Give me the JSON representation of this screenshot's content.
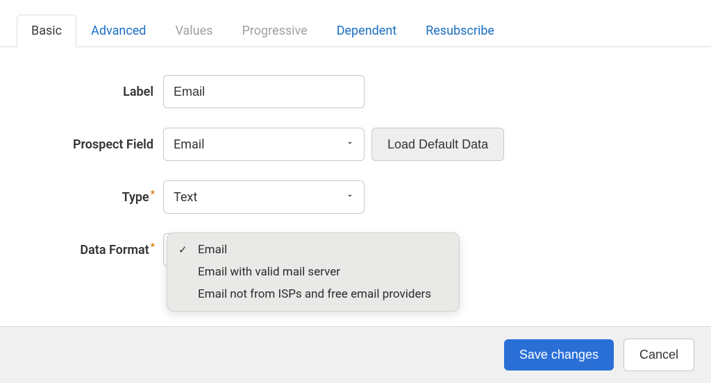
{
  "tabs": {
    "basic": "Basic",
    "advanced": "Advanced",
    "values": "Values",
    "progressive": "Progressive",
    "dependent": "Dependent",
    "resubscribe": "Resubscribe"
  },
  "form": {
    "label": {
      "text": "Label",
      "value": "Email"
    },
    "prospect_field": {
      "text": "Prospect Field",
      "value": "Email",
      "button": "Load Default Data"
    },
    "type": {
      "text": "Type",
      "value": "Text"
    },
    "data_format": {
      "text": "Data Format",
      "options": [
        "Email",
        "Email with valid mail server",
        "Email not from ISPs and free email providers"
      ],
      "selected_index": 0
    }
  },
  "footer": {
    "save": "Save changes",
    "cancel": "Cancel"
  }
}
